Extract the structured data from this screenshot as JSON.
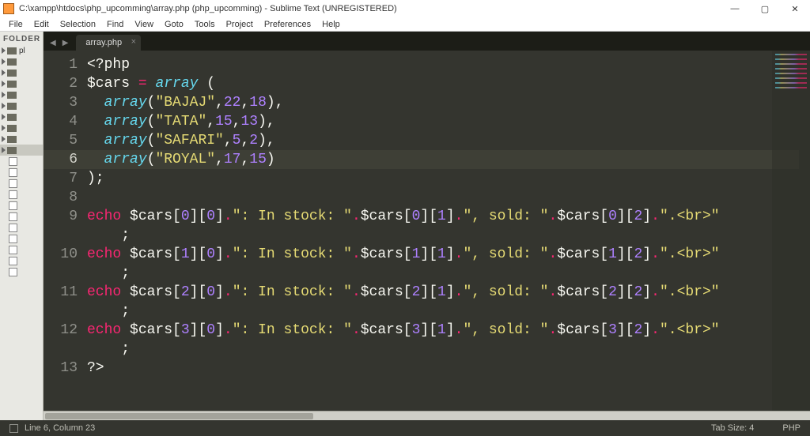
{
  "window": {
    "title": "C:\\xampp\\htdocs\\php_upcomming\\array.php (php_upcomming) - Sublime Text (UNREGISTERED)"
  },
  "menu": [
    "File",
    "Edit",
    "Selection",
    "Find",
    "View",
    "Goto",
    "Tools",
    "Project",
    "Preferences",
    "Help"
  ],
  "winbuttons": {
    "minimize": "—",
    "maximize": "▢",
    "close": "✕"
  },
  "sidebar": {
    "header": "FOLDER",
    "root_label": "pl"
  },
  "tab": {
    "label": "array.php",
    "close": "×"
  },
  "tabnav": {
    "left": "◀",
    "right": "▶"
  },
  "status": {
    "cursor": "Line 6, Column 23",
    "tabsize": "Tab Size: 4",
    "syntax": "PHP"
  },
  "editor": {
    "current_line": 6,
    "lines": [
      [
        {
          "c": "c-gray",
          "t": "<?php"
        }
      ],
      [
        {
          "c": "c-var",
          "t": "$cars "
        },
        {
          "c": "c-dot",
          "t": "="
        },
        {
          "c": "c-gray",
          "t": " "
        },
        {
          "c": "c-func",
          "t": "array"
        },
        {
          "c": "c-gray",
          "t": " ("
        }
      ],
      [
        {
          "c": "c-gray",
          "t": "  "
        },
        {
          "c": "c-func",
          "t": "array"
        },
        {
          "c": "c-gray",
          "t": "("
        },
        {
          "c": "c-str",
          "t": "\"BAJAJ\""
        },
        {
          "c": "c-gray",
          "t": ","
        },
        {
          "c": "c-num",
          "t": "22"
        },
        {
          "c": "c-gray",
          "t": ","
        },
        {
          "c": "c-num",
          "t": "18"
        },
        {
          "c": "c-gray",
          "t": "),"
        }
      ],
      [
        {
          "c": "c-gray",
          "t": "  "
        },
        {
          "c": "c-func",
          "t": "array"
        },
        {
          "c": "c-gray",
          "t": "("
        },
        {
          "c": "c-str",
          "t": "\"TATA\""
        },
        {
          "c": "c-gray",
          "t": ","
        },
        {
          "c": "c-num",
          "t": "15"
        },
        {
          "c": "c-gray",
          "t": ","
        },
        {
          "c": "c-num",
          "t": "13"
        },
        {
          "c": "c-gray",
          "t": "),"
        }
      ],
      [
        {
          "c": "c-gray",
          "t": "  "
        },
        {
          "c": "c-func",
          "t": "array"
        },
        {
          "c": "c-gray",
          "t": "("
        },
        {
          "c": "c-str",
          "t": "\"SAFARI\""
        },
        {
          "c": "c-gray",
          "t": ","
        },
        {
          "c": "c-num",
          "t": "5"
        },
        {
          "c": "c-gray",
          "t": ","
        },
        {
          "c": "c-num",
          "t": "2"
        },
        {
          "c": "c-gray",
          "t": "),"
        }
      ],
      [
        {
          "c": "c-gray",
          "t": "  "
        },
        {
          "c": "c-func",
          "t": "array"
        },
        {
          "c": "c-gray",
          "t": "("
        },
        {
          "c": "c-str",
          "t": "\"ROYAL\""
        },
        {
          "c": "c-gray",
          "t": ","
        },
        {
          "c": "c-num",
          "t": "17"
        },
        {
          "c": "c-gray",
          "t": ","
        },
        {
          "c": "c-num",
          "t": "15"
        },
        {
          "c": "c-gray",
          "t": ")"
        }
      ],
      [
        {
          "c": "c-gray",
          "t": ");"
        }
      ],
      [
        {
          "c": "c-gray",
          "t": ""
        }
      ],
      [
        {
          "c": "c-kw",
          "t": "echo "
        },
        {
          "c": "c-var",
          "t": "$cars"
        },
        {
          "c": "c-gray",
          "t": "["
        },
        {
          "c": "c-num",
          "t": "0"
        },
        {
          "c": "c-gray",
          "t": "]["
        },
        {
          "c": "c-num",
          "t": "0"
        },
        {
          "c": "c-gray",
          "t": "]"
        },
        {
          "c": "c-dot",
          "t": "."
        },
        {
          "c": "c-str",
          "t": "\": In stock: \""
        },
        {
          "c": "c-dot",
          "t": "."
        },
        {
          "c": "c-var",
          "t": "$cars"
        },
        {
          "c": "c-gray",
          "t": "["
        },
        {
          "c": "c-num",
          "t": "0"
        },
        {
          "c": "c-gray",
          "t": "]["
        },
        {
          "c": "c-num",
          "t": "1"
        },
        {
          "c": "c-gray",
          "t": "]"
        },
        {
          "c": "c-dot",
          "t": "."
        },
        {
          "c": "c-str",
          "t": "\", sold: \""
        },
        {
          "c": "c-dot",
          "t": "."
        },
        {
          "c": "c-var",
          "t": "$cars"
        },
        {
          "c": "c-gray",
          "t": "["
        },
        {
          "c": "c-num",
          "t": "0"
        },
        {
          "c": "c-gray",
          "t": "]["
        },
        {
          "c": "c-num",
          "t": "2"
        },
        {
          "c": "c-gray",
          "t": "]"
        },
        {
          "c": "c-dot",
          "t": "."
        },
        {
          "c": "c-str",
          "t": "\".<br>\""
        }
      ],
      [
        {
          "c": "c-gray",
          "t": "    ;"
        }
      ],
      [
        {
          "c": "c-kw",
          "t": "echo "
        },
        {
          "c": "c-var",
          "t": "$cars"
        },
        {
          "c": "c-gray",
          "t": "["
        },
        {
          "c": "c-num",
          "t": "1"
        },
        {
          "c": "c-gray",
          "t": "]["
        },
        {
          "c": "c-num",
          "t": "0"
        },
        {
          "c": "c-gray",
          "t": "]"
        },
        {
          "c": "c-dot",
          "t": "."
        },
        {
          "c": "c-str",
          "t": "\": In stock: \""
        },
        {
          "c": "c-dot",
          "t": "."
        },
        {
          "c": "c-var",
          "t": "$cars"
        },
        {
          "c": "c-gray",
          "t": "["
        },
        {
          "c": "c-num",
          "t": "1"
        },
        {
          "c": "c-gray",
          "t": "]["
        },
        {
          "c": "c-num",
          "t": "1"
        },
        {
          "c": "c-gray",
          "t": "]"
        },
        {
          "c": "c-dot",
          "t": "."
        },
        {
          "c": "c-str",
          "t": "\", sold: \""
        },
        {
          "c": "c-dot",
          "t": "."
        },
        {
          "c": "c-var",
          "t": "$cars"
        },
        {
          "c": "c-gray",
          "t": "["
        },
        {
          "c": "c-num",
          "t": "1"
        },
        {
          "c": "c-gray",
          "t": "]["
        },
        {
          "c": "c-num",
          "t": "2"
        },
        {
          "c": "c-gray",
          "t": "]"
        },
        {
          "c": "c-dot",
          "t": "."
        },
        {
          "c": "c-str",
          "t": "\".<br>\""
        }
      ],
      [
        {
          "c": "c-gray",
          "t": "    ;"
        }
      ],
      [
        {
          "c": "c-kw",
          "t": "echo "
        },
        {
          "c": "c-var",
          "t": "$cars"
        },
        {
          "c": "c-gray",
          "t": "["
        },
        {
          "c": "c-num",
          "t": "2"
        },
        {
          "c": "c-gray",
          "t": "]["
        },
        {
          "c": "c-num",
          "t": "0"
        },
        {
          "c": "c-gray",
          "t": "]"
        },
        {
          "c": "c-dot",
          "t": "."
        },
        {
          "c": "c-str",
          "t": "\": In stock: \""
        },
        {
          "c": "c-dot",
          "t": "."
        },
        {
          "c": "c-var",
          "t": "$cars"
        },
        {
          "c": "c-gray",
          "t": "["
        },
        {
          "c": "c-num",
          "t": "2"
        },
        {
          "c": "c-gray",
          "t": "]["
        },
        {
          "c": "c-num",
          "t": "1"
        },
        {
          "c": "c-gray",
          "t": "]"
        },
        {
          "c": "c-dot",
          "t": "."
        },
        {
          "c": "c-str",
          "t": "\", sold: \""
        },
        {
          "c": "c-dot",
          "t": "."
        },
        {
          "c": "c-var",
          "t": "$cars"
        },
        {
          "c": "c-gray",
          "t": "["
        },
        {
          "c": "c-num",
          "t": "2"
        },
        {
          "c": "c-gray",
          "t": "]["
        },
        {
          "c": "c-num",
          "t": "2"
        },
        {
          "c": "c-gray",
          "t": "]"
        },
        {
          "c": "c-dot",
          "t": "."
        },
        {
          "c": "c-str",
          "t": "\".<br>\""
        }
      ],
      [
        {
          "c": "c-gray",
          "t": "    ;"
        }
      ],
      [
        {
          "c": "c-kw",
          "t": "echo "
        },
        {
          "c": "c-var",
          "t": "$cars"
        },
        {
          "c": "c-gray",
          "t": "["
        },
        {
          "c": "c-num",
          "t": "3"
        },
        {
          "c": "c-gray",
          "t": "]["
        },
        {
          "c": "c-num",
          "t": "0"
        },
        {
          "c": "c-gray",
          "t": "]"
        },
        {
          "c": "c-dot",
          "t": "."
        },
        {
          "c": "c-str",
          "t": "\": In stock: \""
        },
        {
          "c": "c-dot",
          "t": "."
        },
        {
          "c": "c-var",
          "t": "$cars"
        },
        {
          "c": "c-gray",
          "t": "["
        },
        {
          "c": "c-num",
          "t": "3"
        },
        {
          "c": "c-gray",
          "t": "]["
        },
        {
          "c": "c-num",
          "t": "1"
        },
        {
          "c": "c-gray",
          "t": "]"
        },
        {
          "c": "c-dot",
          "t": "."
        },
        {
          "c": "c-str",
          "t": "\", sold: \""
        },
        {
          "c": "c-dot",
          "t": "."
        },
        {
          "c": "c-var",
          "t": "$cars"
        },
        {
          "c": "c-gray",
          "t": "["
        },
        {
          "c": "c-num",
          "t": "3"
        },
        {
          "c": "c-gray",
          "t": "]["
        },
        {
          "c": "c-num",
          "t": "2"
        },
        {
          "c": "c-gray",
          "t": "]"
        },
        {
          "c": "c-dot",
          "t": "."
        },
        {
          "c": "c-str",
          "t": "\".<br>\""
        }
      ],
      [
        {
          "c": "c-gray",
          "t": "    ;"
        }
      ],
      [
        {
          "c": "c-gray",
          "t": "?>"
        }
      ]
    ],
    "wrap_indices": [
      8,
      10,
      12,
      14
    ],
    "display_numbers": [
      1,
      2,
      3,
      4,
      5,
      6,
      7,
      8,
      9,
      null,
      10,
      null,
      11,
      null,
      12,
      null,
      13
    ]
  }
}
